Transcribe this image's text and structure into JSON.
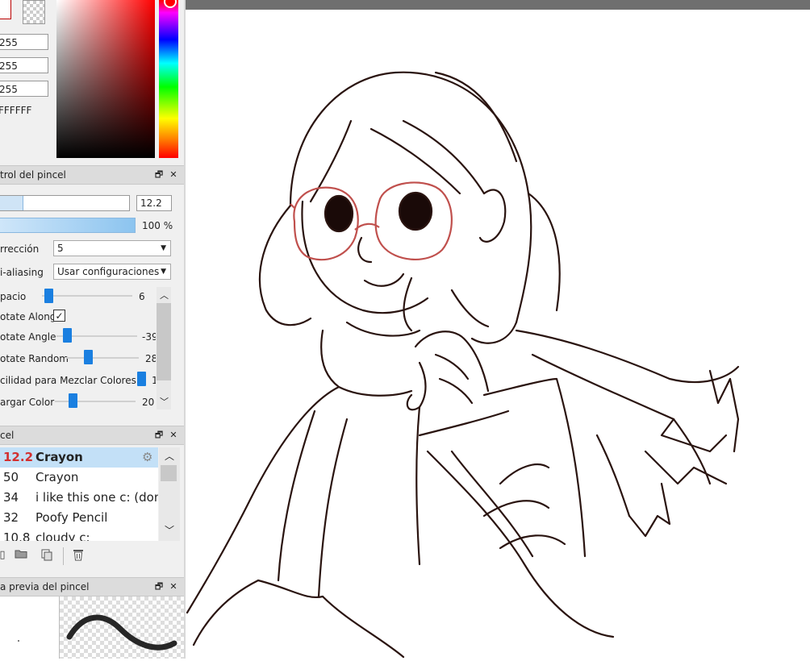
{
  "color": {
    "r": "255",
    "g": "255",
    "b": "255",
    "hex": "FFFFFF",
    "primary_color": "#ffffff",
    "hue_color": "#ff0000"
  },
  "brush_control": {
    "title": "trol del pincel",
    "size_value": "12.2",
    "density_value": "100 %",
    "correction_label": "rrección",
    "correction_value": "5",
    "antialias_label": "i-aliasing",
    "antialias_value": "Usar configuraciones",
    "params": [
      {
        "label": "pacio",
        "value": "6"
      },
      {
        "label": "otate Along",
        "value": ""
      },
      {
        "label": "otate Angle",
        "value": "-39"
      },
      {
        "label": "otate Random",
        "value": "28"
      },
      {
        "label": "cilidad para Mezclar Colores",
        "value": "1"
      },
      {
        "label": "argar Color",
        "value": "20"
      }
    ],
    "rotate_along_checked": true
  },
  "brush_list": {
    "title": "cel",
    "items": [
      {
        "size": "12.2",
        "name": "Crayon",
        "selected": true
      },
      {
        "size": "50",
        "name": "Crayon",
        "selected": false
      },
      {
        "size": "34",
        "name": "i like this one c: (don'",
        "selected": false
      },
      {
        "size": "32",
        "name": "Poofy Pencil",
        "selected": false
      },
      {
        "size": "10.8",
        "name": "cloudy c:",
        "selected": false
      }
    ]
  },
  "preview": {
    "title": "a previa del pincel"
  },
  "icons": [
    "window-restore-icon",
    "close-icon",
    "gear-icon",
    "folder-icon",
    "duplicate-icon",
    "trash-icon",
    "chevron-down-icon",
    "chevron-up-icon",
    "checkbox-icon"
  ]
}
